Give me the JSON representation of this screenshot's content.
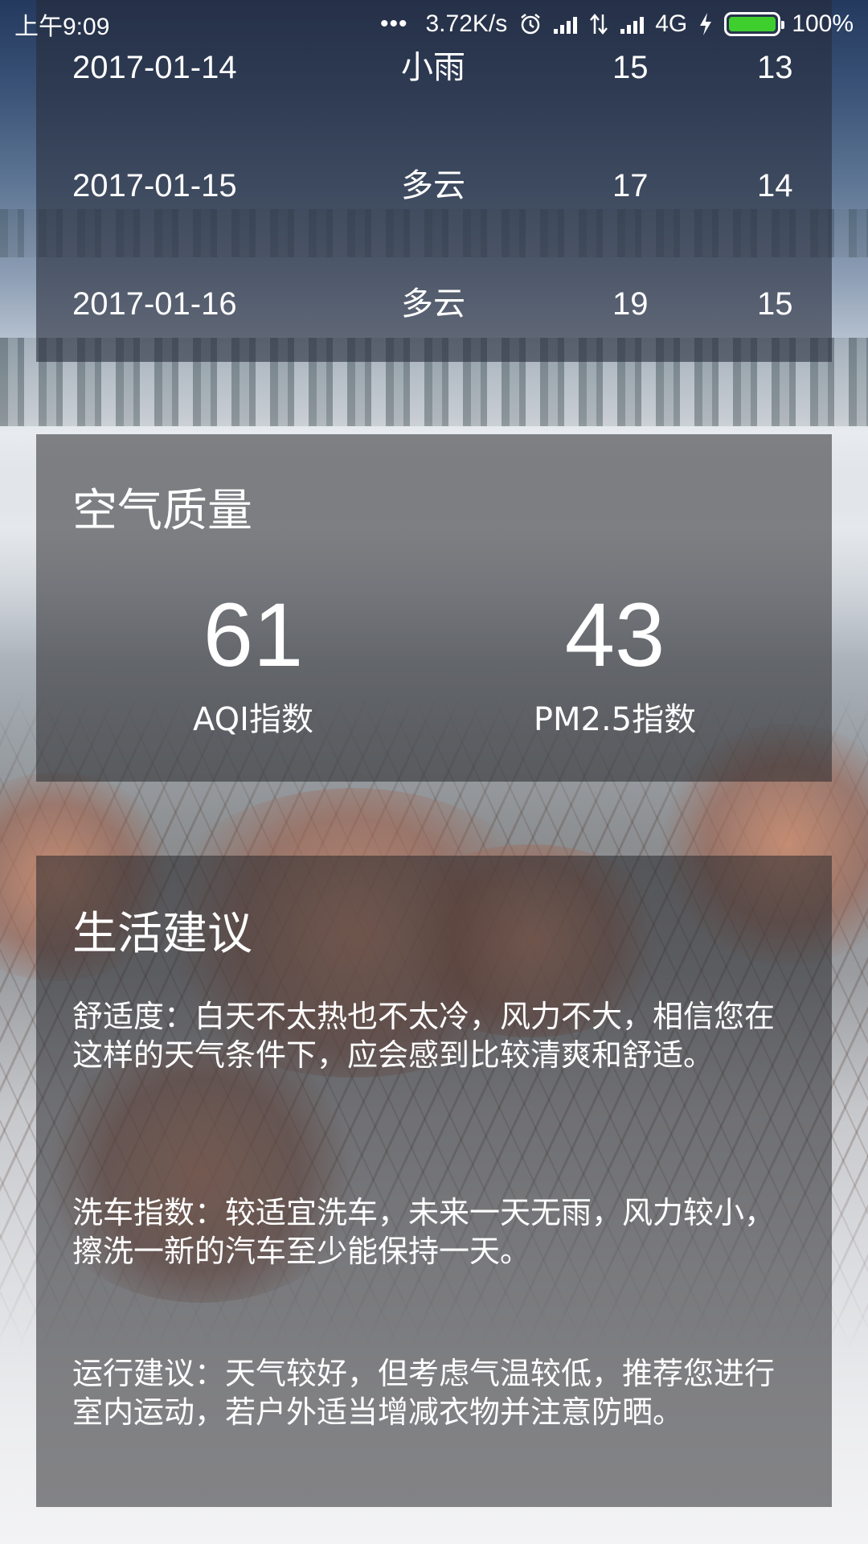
{
  "status_bar": {
    "time": "上午9:09",
    "more_indicator": "•••",
    "network_speed": "3.72K/s",
    "network_type": "4G",
    "battery_percent": "100%",
    "battery_level": 1.0,
    "battery_color": "#3ecf2f",
    "icons": [
      "alarm-clock-icon",
      "signal-icon",
      "data-transfer-icon",
      "signal-icon",
      "charging-bolt-icon",
      "battery-icon"
    ]
  },
  "forecast": {
    "rows": [
      {
        "date": "2017-01-14",
        "weather": "小雨",
        "max": "15",
        "min": "13"
      },
      {
        "date": "2017-01-15",
        "weather": "多云",
        "max": "17",
        "min": "14"
      },
      {
        "date": "2017-01-16",
        "weather": "多云",
        "max": "19",
        "min": "15"
      }
    ]
  },
  "aqi": {
    "title": "空气质量",
    "aqi_value": "61",
    "aqi_label": "AQI指数",
    "pm25_value": "43",
    "pm25_label": "PM2.5指数"
  },
  "suggestion": {
    "title": "生活建议",
    "comfort": "舒适度：白天不太热也不太冷，风力不大，相信您在这样的天气条件下，应会感到比较清爽和舒适。",
    "car_wash": "洗车指数：较适宜洗车，未来一天无雨，风力较小，擦洗一新的汽车至少能保持一天。",
    "sport": "运行建议：天气较好，但考虑气温较低，推荐您进行室内运动，若户外适当增减衣物并注意防晒。"
  }
}
